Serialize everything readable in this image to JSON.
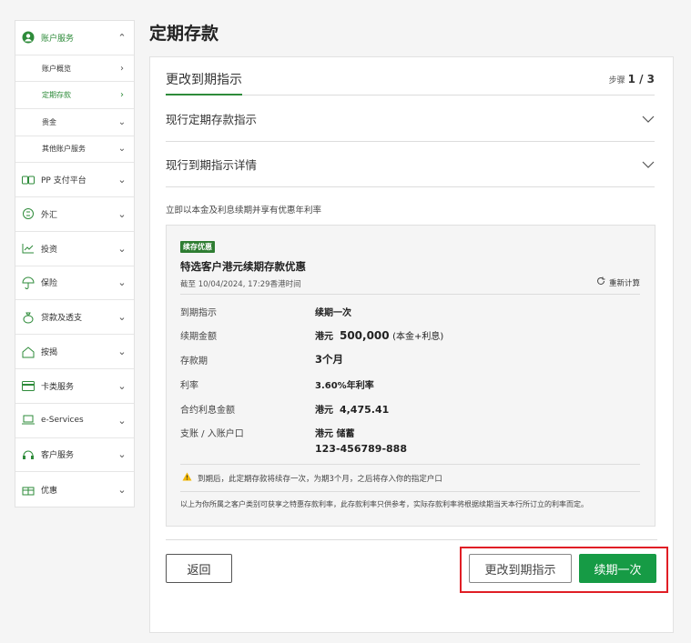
{
  "sidebar": {
    "items": [
      {
        "label": "账户服务",
        "icon": "user-icon",
        "open": true
      },
      {
        "label": "PP 支付平台",
        "icon": "card-transfer-icon"
      },
      {
        "label": "外汇",
        "icon": "exchange-icon"
      },
      {
        "label": "投资",
        "icon": "chart-icon"
      },
      {
        "label": "保险",
        "icon": "umbrella-icon"
      },
      {
        "label": "贷款及透支",
        "icon": "money-bag-icon"
      },
      {
        "label": "按揭",
        "icon": "house-icon"
      },
      {
        "label": "卡类服务",
        "icon": "credit-card-icon"
      },
      {
        "label": "e-Services",
        "icon": "laptop-icon"
      },
      {
        "label": "客户服务",
        "icon": "headset-icon"
      },
      {
        "label": "优惠",
        "icon": "gift-icon"
      }
    ],
    "sub_items": [
      {
        "label": "账户概览"
      },
      {
        "label": "定期存款",
        "active": true
      },
      {
        "label": "贵金"
      },
      {
        "label": "其他账户服务"
      }
    ]
  },
  "page_title": "定期存款",
  "header": {
    "tab_label": "更改到期指示",
    "step_prefix": "步骤",
    "step_value": "1 / 3"
  },
  "accordions": [
    {
      "label": "现行定期存款指示"
    },
    {
      "label": "现行到期指示详情"
    }
  ],
  "intro_text": "立即以本金及利息续期并享有优惠年利率",
  "offer": {
    "badge": "续存优惠",
    "title": "特选客户港元续期存款优惠",
    "time": "截至 10/04/2024, 17:29香港时间",
    "recalc_label": "重新计算",
    "rows": [
      {
        "key": "到期指示",
        "value": "续期一次"
      },
      {
        "key": "续期金额",
        "currency": "港元",
        "amount": "500,000",
        "suffix": "(本金+利息)"
      },
      {
        "key": "存款期",
        "value": "3个月"
      },
      {
        "key": "利率",
        "value": "3.60%年利率"
      },
      {
        "key": "合约利息金额",
        "currency": "港元",
        "amount": "4,475.41"
      },
      {
        "key": "支账 / 入账户口",
        "value": "港元 储蓄"
      }
    ],
    "account_number": "123-456789-888",
    "warning": "到期后，此定期存款将续存一次，为期3个月，之后将存入你的指定户口",
    "note": "以上为你所属之客户类别可获享之特惠存款利率，此存款利率只供参考，实际存款利率将根据续期当天本行所订立的利率而定。"
  },
  "buttons": {
    "back": "返回",
    "change": "更改到期指示",
    "renew": "续期一次"
  },
  "colors": {
    "brand_green": "#169b45",
    "highlight_red": "#e01e25"
  }
}
